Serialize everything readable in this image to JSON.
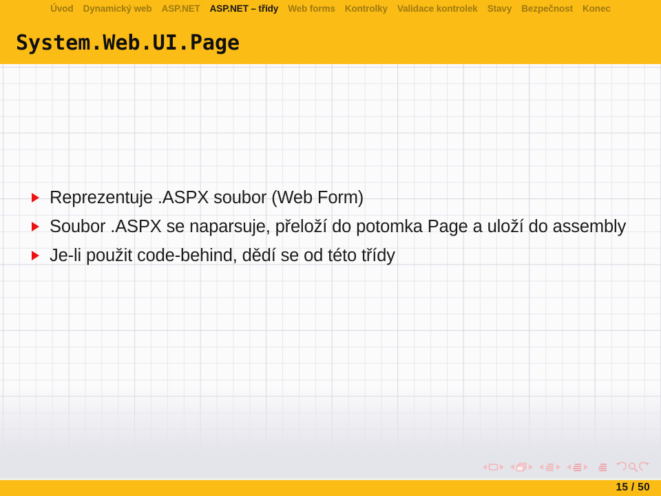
{
  "navbar": {
    "items": [
      {
        "label": "Úvod",
        "active": false
      },
      {
        "label": "Dynamický web",
        "active": false
      },
      {
        "label": "ASP.NET",
        "active": false
      },
      {
        "label": "ASP.NET – třídy",
        "active": true
      },
      {
        "label": "Web forms",
        "active": false
      },
      {
        "label": "Kontrolky",
        "active": false
      },
      {
        "label": "Validace kontrolek",
        "active": false
      },
      {
        "label": "Stavy",
        "active": false
      },
      {
        "label": "Bezpečnost",
        "active": false
      },
      {
        "label": "Konec",
        "active": false
      }
    ]
  },
  "header": {
    "title": "System.Web.UI.Page"
  },
  "content": {
    "bullets": [
      "Reprezentuje .ASPX soubor (Web Form)",
      "Soubor .ASPX se naparsuje, přeloží do potomka Page a uloží do assembly",
      "Je-li použit code-behind, dědí se od této třídy"
    ]
  },
  "navigation_symbols": {
    "groups": [
      {
        "icon": "slide-icon",
        "prev": "◀",
        "next": "▶"
      },
      {
        "icon": "frame-icon",
        "prev": "◀",
        "next": "▶"
      },
      {
        "icon": "subsection-icon",
        "prev": "◀",
        "next": "▶"
      },
      {
        "icon": "section-icon",
        "prev": "◀",
        "next": "▶"
      }
    ],
    "appendix": "appendix-icon",
    "back": "back-icon",
    "search": "search-icon",
    "forward": "forward-icon"
  },
  "footer": {
    "page": "15 / 50",
    "current_page": 15,
    "total_pages": 50
  },
  "colors": {
    "accent": "#fcbc16",
    "nav_inactive": "#9d7a10",
    "nav_active": "#151515",
    "bullet_marker": "#ee1111",
    "body_text": "#1b1b1b",
    "navsym": "#f3bcbe",
    "grid_bg": "#fbfbfc",
    "lower_band": "#e4e4eb"
  }
}
